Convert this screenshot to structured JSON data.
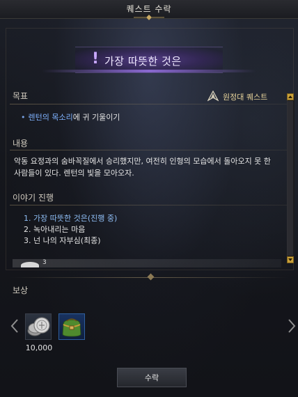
{
  "window": {
    "title": "퀘스트 수락"
  },
  "quest": {
    "title_prefix": "!",
    "title": "가장 따뜻한 것은"
  },
  "goal": {
    "label": "목표",
    "quest_type": "원정대 퀘스트",
    "objective_highlight": "렌턴의 목소리",
    "objective_rest": "에 귀 기울이기"
  },
  "content": {
    "label": "내용",
    "text": "악동 요정과의 숨바꼭질에서 승리했지만, 여전히 인형의 모습에서 돌아오지 못 한 사람들이 있다. 렌턴의 빛을 모아오자."
  },
  "story": {
    "label": "이야기 진행",
    "steps": [
      "1. 가장 따뜻한 것은(진행 중)",
      "2. 녹아내리는 마음",
      "3. 넌 나의 자부심(최종)"
    ]
  },
  "peek": {
    "count": "3"
  },
  "rewards": {
    "label": "보상",
    "items": [
      {
        "icon": "silver-coins-icon",
        "quantity": "10,000"
      },
      {
        "icon": "green-bag-icon",
        "quantity": ""
      }
    ]
  },
  "accept_button": {
    "label": "수락"
  },
  "colors": {
    "accent_purple": "#7a55c8",
    "highlight_blue": "#7fb2ff",
    "gold": "#e6d29a",
    "scroll_gold": "#c9a13a"
  }
}
